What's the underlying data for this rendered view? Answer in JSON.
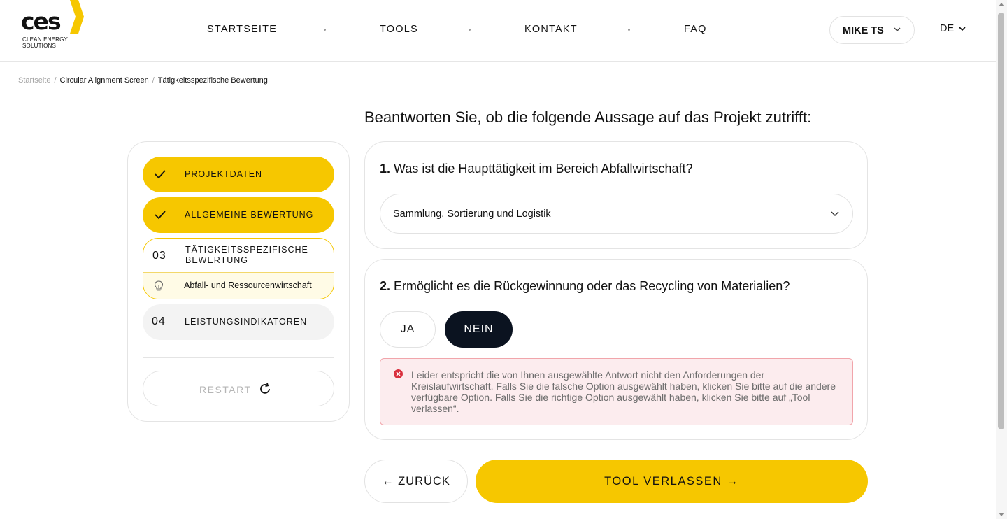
{
  "brand": {
    "logo_text": "ces",
    "logo_sub": "CLEAN ENERGY SOLUTIONS",
    "accent": "#f6c700",
    "dark": "#0b1320"
  },
  "nav": {
    "items": [
      {
        "label": "STARTSEITE"
      },
      {
        "label": "TOOLS"
      },
      {
        "label": "KONTAKT"
      },
      {
        "label": "FAQ"
      }
    ]
  },
  "user": {
    "name": "MIKE TS"
  },
  "language": {
    "selected": "DE"
  },
  "breadcrumb": {
    "items": [
      "Startseite",
      "Circular Alignment Screen",
      "Tätigkeitsspezifische Bewertung"
    ]
  },
  "sidebar": {
    "steps": [
      {
        "label": "PROJEKTDATEN",
        "status": "done",
        "icon": "check-icon"
      },
      {
        "label": "ALLGEMEINE BEWERTUNG",
        "status": "done",
        "icon": "check-icon"
      },
      {
        "number": "03",
        "label": "TÄTIGKEITSSPEZIFISCHE BEWERTUNG",
        "status": "active",
        "sub_label": "Abfall- und Ressourcenwirtschaft",
        "sub_icon": "lightbulb-icon"
      },
      {
        "number": "04",
        "label": "LEISTUNGSINDIKATOREN",
        "status": "pending"
      }
    ],
    "restart_label": "RESTART"
  },
  "main": {
    "heading": "Beantworten Sie, ob die folgende Aussage auf das Projekt zutrifft:",
    "question1": {
      "number": "1.",
      "text": "Was ist die Haupttätigkeit im Bereich Abfallwirtschaft?",
      "selected_value": "Sammlung, Sortierung und Logistik"
    },
    "question2": {
      "number": "2.",
      "text": "Ermöglicht es die Rückgewinnung oder das Recycling von Materialien?",
      "options": [
        "JA",
        "NEIN"
      ],
      "selected": "NEIN",
      "alert": "Leider entspricht die von Ihnen ausgewählte Antwort nicht den Anforderungen der Kreislaufwirtschaft. Falls Sie die falsche Option ausgewählt haben, klicken Sie bitte auf die andere verfügbare Option. Falls Sie die richtige Option ausgewählt haben, klicken Sie bitte auf „Tool verlassen“."
    }
  },
  "actions": {
    "back_label": "← ZURÜCK",
    "exit_label": "TOOL VERLASSEN →"
  }
}
